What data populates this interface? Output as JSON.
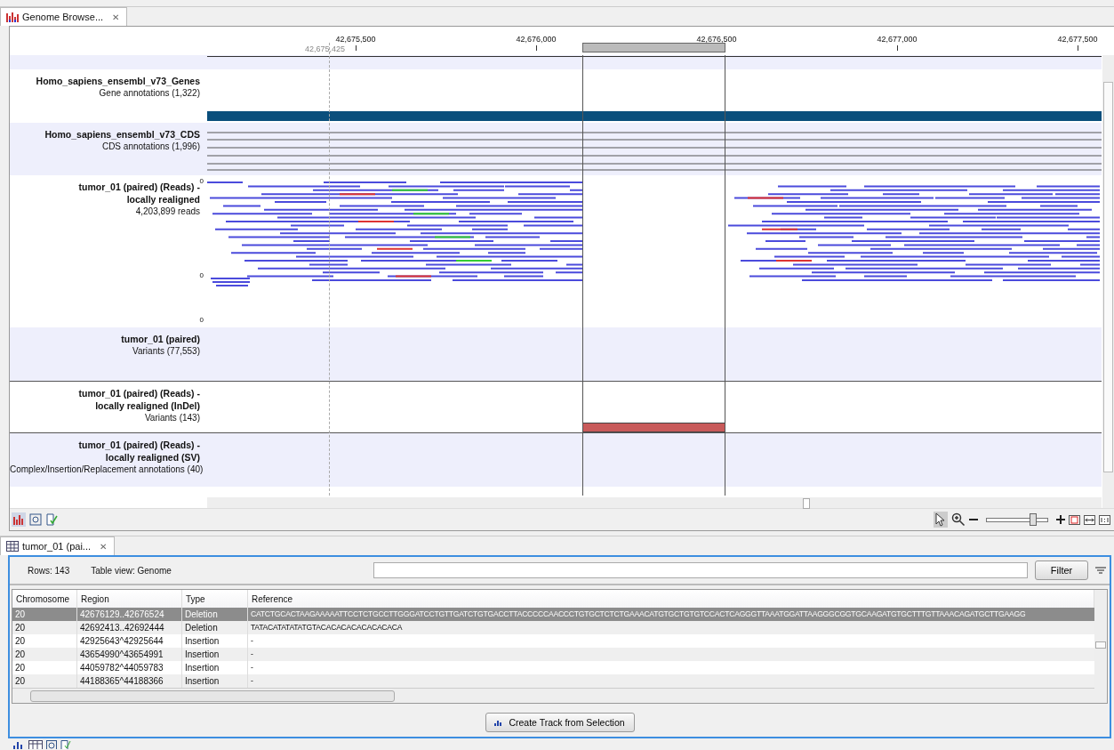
{
  "browser_tab": {
    "label": "Genome Browse...",
    "close": "✕",
    "selected": true
  },
  "ruler": {
    "ticks": [
      "42,675,500",
      "42,676,000",
      "42,676,500",
      "42,677,000",
      "42,677,500"
    ],
    "cursor": "42,675,425"
  },
  "tracks": [
    {
      "kind": "sequence"
    },
    {
      "kind": "genes",
      "title": [
        "Homo_sapiens_ensembl_v73_Genes"
      ],
      "subtitle": "Gene annotations (1,322)"
    },
    {
      "kind": "cds",
      "title": [
        "Homo_sapiens_ensembl_v73_CDS"
      ],
      "subtitle": "CDS annotations (1,996)"
    },
    {
      "kind": "reads",
      "title": [
        "tumor_01 (paired) (Reads) -",
        "locally realigned"
      ],
      "subtitle": "4,203,899 reads",
      "axis": [
        "0",
        "0",
        "0"
      ]
    },
    {
      "kind": "empty",
      "title": [
        "tumor_01 (paired)"
      ],
      "subtitle": "Variants (77,553)"
    },
    {
      "kind": "indel",
      "title": [
        "tumor_01 (paired) (Reads) -",
        "locally realigned (InDel)"
      ],
      "subtitle": "Variants (143)"
    },
    {
      "kind": "empty",
      "title": [
        "tumor_01 (paired) (Reads) -",
        "locally realigned (SV)"
      ],
      "subtitle": "Complex/Insertion/Replacement annotations (40)"
    }
  ],
  "zoom_slider": {
    "level": 0.77
  },
  "table_tab": {
    "label": "tumor_01 (pai...",
    "close": "✕",
    "selected": true
  },
  "table_info": {
    "rows": "Rows: 143",
    "view": "Table view: Genome"
  },
  "filter": {
    "button": "Filter"
  },
  "table": {
    "columns": [
      "Chromosome",
      "Region",
      "Type",
      "Reference"
    ],
    "rows": [
      {
        "selected": true,
        "cells": [
          "20",
          "42676129..42676524",
          "Deletion",
          "CATCTGCACTAAGAAAAATTCCTCTGCCTTGGGATCCTGTTGATCTGTGACCTTACCCCCAACCCTGTGCTCTCTGAAACATGTGCTGTGTCCACTCAGGGTTAAATGGATTAAGGGCGGTGCAAGATGTGCTTTGTTAAACAGATGCTTGAAGG"
        ]
      },
      {
        "selected": false,
        "cells": [
          "20",
          "42692413..42692444",
          "Deletion",
          "TATACATATATATGTACACACACACACACACA"
        ]
      },
      {
        "selected": false,
        "cells": [
          "20",
          "42925643^42925644",
          "Insertion",
          "-"
        ]
      },
      {
        "selected": false,
        "cells": [
          "20",
          "43654990^43654991",
          "Insertion",
          "-"
        ]
      },
      {
        "selected": false,
        "cells": [
          "20",
          "44059782^44059783",
          "Insertion",
          "-"
        ]
      },
      {
        "selected": false,
        "cells": [
          "20",
          "44188365^44188366",
          "Insertion",
          "-"
        ]
      }
    ]
  },
  "create_button": {
    "label": "Create Track from Selection"
  }
}
